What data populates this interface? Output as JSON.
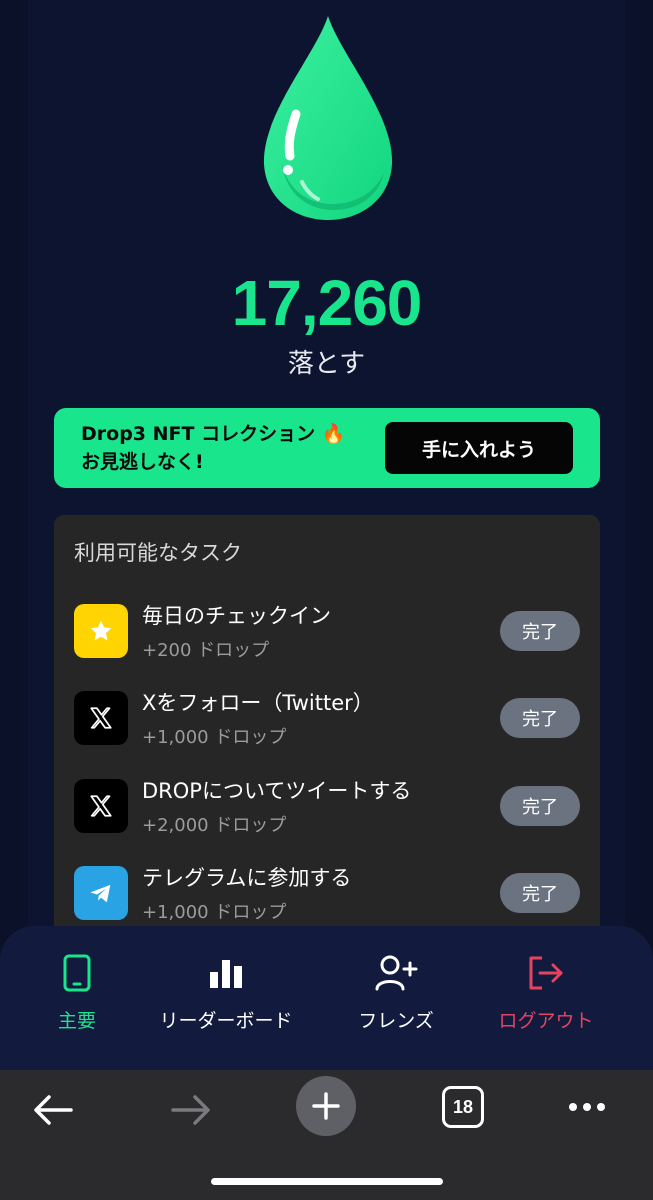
{
  "colors": {
    "accent": "#19e68c",
    "promo_bg": "#19e68c",
    "logout": "#e5445f",
    "task_star_bg": "#ffd400",
    "task_x_bg": "#000000",
    "task_telegram_bg": "#2aa3e4"
  },
  "hero": {
    "icon": "water-drop-icon",
    "balance": "17,260",
    "unit_label": "落とす"
  },
  "promo": {
    "line1": "Drop3 NFT コレクション 🔥",
    "line2": "お見逃しなく!",
    "button_label": "手に入れよう"
  },
  "tasks": {
    "title": "利用可能なタスク",
    "items": [
      {
        "icon": "star-icon",
        "name": "毎日のチェックイン",
        "reward": "+200 ドロップ",
        "button": "完了"
      },
      {
        "icon": "x-logo-icon",
        "name": "Xをフォロー（Twitter）",
        "reward": "+1,000 ドロップ",
        "button": "完了"
      },
      {
        "icon": "x-logo-icon",
        "name": "DROPについてツイートする",
        "reward": "+2,000 ドロップ",
        "button": "完了"
      },
      {
        "icon": "telegram-icon",
        "name": "テレグラムに参加する",
        "reward": "+1,000 ドロップ",
        "button": "完了"
      }
    ]
  },
  "nav": {
    "items": [
      {
        "icon": "phone-icon",
        "label": "主要"
      },
      {
        "icon": "bar-chart-icon",
        "label": "リーダーボード"
      },
      {
        "icon": "add-user-icon",
        "label": "フレンズ"
      },
      {
        "icon": "logout-icon",
        "label": "ログアウト"
      }
    ]
  },
  "browser": {
    "tab_count": "18"
  }
}
